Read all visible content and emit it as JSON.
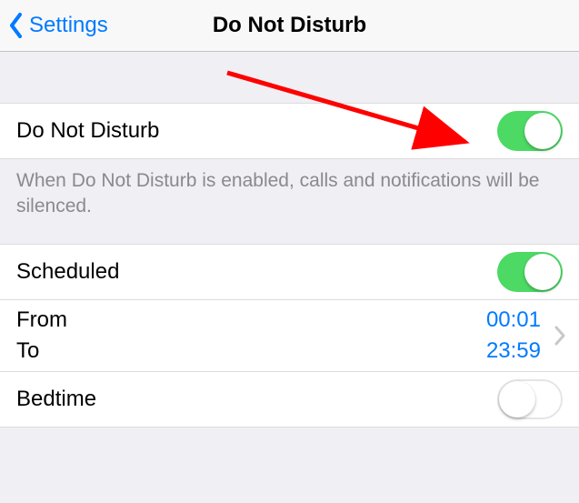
{
  "nav": {
    "back_label": "Settings",
    "title": "Do Not Disturb"
  },
  "dnd": {
    "label": "Do Not Disturb",
    "on": true,
    "footer": "When Do Not Disturb is enabled, calls and notifications will be silenced."
  },
  "schedule": {
    "scheduled_label": "Scheduled",
    "scheduled_on": true,
    "from_label": "From",
    "to_label": "To",
    "from_value": "00:01",
    "to_value": "23:59"
  },
  "bedtime": {
    "label": "Bedtime",
    "on": false
  }
}
